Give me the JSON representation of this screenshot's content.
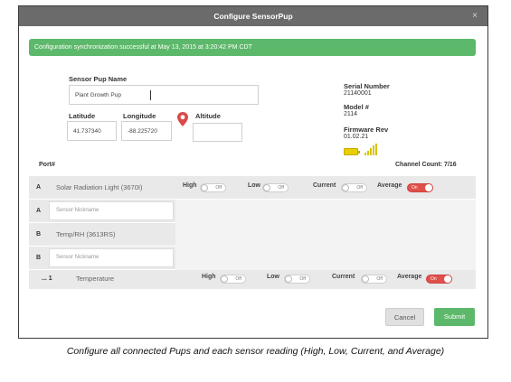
{
  "dialog": {
    "title": "Configure SensorPup",
    "close_glyph": "×",
    "banner": "Configuration synchronization successful at May 13, 2015 at 3:20:42 PM CDT"
  },
  "form": {
    "name_label": "Sensor Pup Name",
    "name_value": "Plant Growth Pup",
    "latitude_label": "Latitude",
    "latitude_value": "41.737340",
    "longitude_label": "Longitude",
    "longitude_value": "-88.225720",
    "altitude_label": "Altitude",
    "altitude_value": ""
  },
  "meta": {
    "serial_label": "Serial Number",
    "serial_value": "21140001",
    "model_label": "Model #",
    "model_value": "2114",
    "firmware_label": "Firmware Rev",
    "firmware_value": "01.02.21",
    "battery_icon": "battery-icon",
    "signal_icon": "signal-strength-icon"
  },
  "table": {
    "port_header": "Port#",
    "channel_count": "Channel Count: 7/16",
    "rows": [
      {
        "port": "A",
        "sensor": "Solar Radiation Light (3670I)"
      },
      {
        "port": "A",
        "nickname_placeholder": "Sensor Nickname"
      },
      {
        "port": "B",
        "sensor": "Temp/RH (3613RS)"
      },
      {
        "port": "B",
        "nickname_placeholder": "Sensor Nickname"
      },
      {
        "port": "... 1",
        "sensor": "Temperature"
      }
    ],
    "metrics": {
      "high": "High",
      "low": "Low",
      "current": "Current",
      "average": "Average",
      "off": "Off",
      "on": "On"
    }
  },
  "buttons": {
    "cancel": "Cancel",
    "submit": "Submit"
  },
  "caption": "Configure all connected Pups and each sensor reading (High, Low, Current, and Average)",
  "colors": {
    "accent_green": "#5cb86a",
    "toggle_on": "#e0504a",
    "titlebar": "#6b6b6b"
  }
}
